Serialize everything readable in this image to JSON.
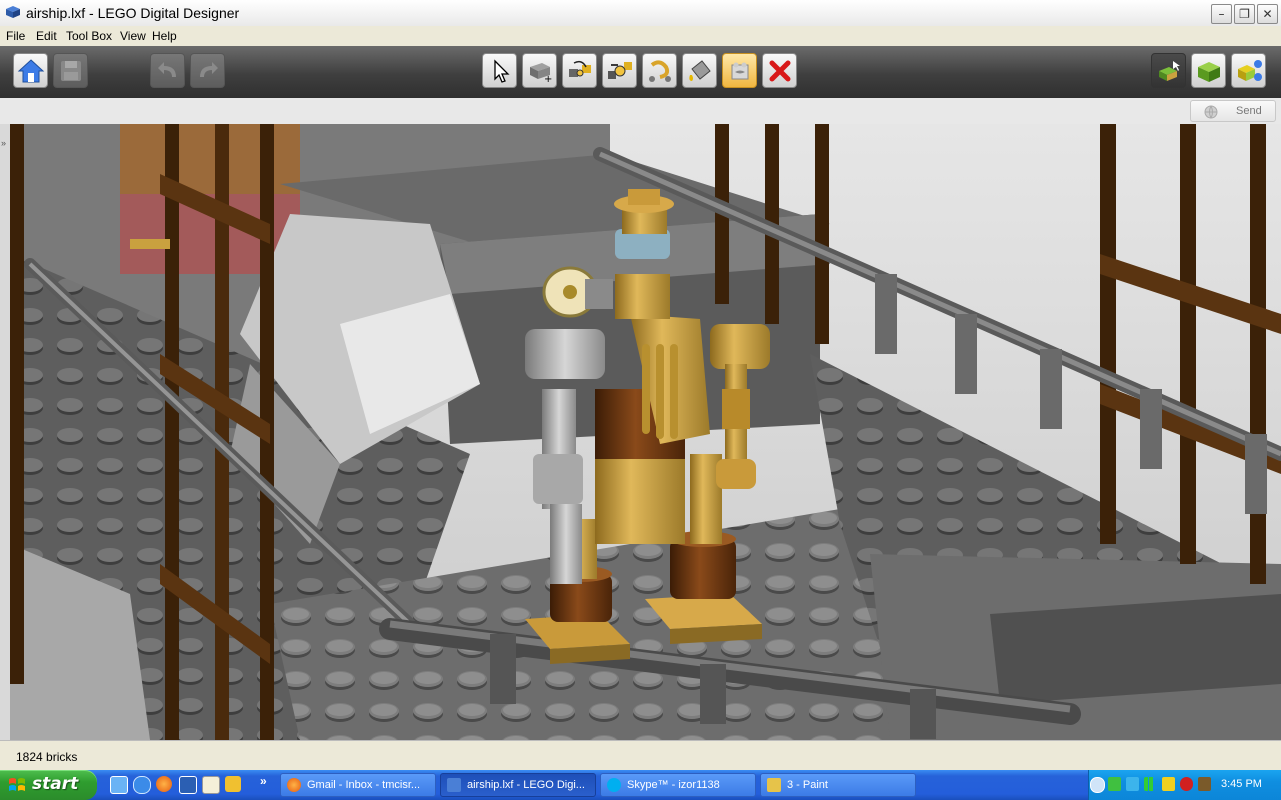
{
  "window": {
    "title": "airship.lxf - LEGO Digital Designer",
    "controls": [
      "minimize",
      "maximize",
      "close"
    ]
  },
  "menu": {
    "items": [
      "File",
      "Edit",
      "Tool Box",
      "View",
      "Help"
    ]
  },
  "toolbar": {
    "left": [
      {
        "name": "home-button",
        "icon": "home-icon"
      },
      {
        "name": "save-button",
        "icon": "floppy-icon"
      },
      {
        "name": "undo-button",
        "icon": "undo-arrow-icon"
      },
      {
        "name": "redo-button",
        "icon": "redo-arrow-icon"
      }
    ],
    "center": [
      {
        "name": "select-tool",
        "icon": "cursor-icon"
      },
      {
        "name": "clone-tool",
        "icon": "clone-brick-icon"
      },
      {
        "name": "hinge-tool",
        "icon": "hinge-icon"
      },
      {
        "name": "hinge-align-tool",
        "icon": "hinge-align-icon"
      },
      {
        "name": "flex-tool",
        "icon": "flex-icon"
      },
      {
        "name": "paint-tool",
        "icon": "paint-bucket-icon"
      },
      {
        "name": "hide-tool",
        "icon": "hide-icon",
        "active": true
      },
      {
        "name": "delete-tool",
        "icon": "red-x-icon"
      }
    ],
    "right": [
      {
        "name": "build-mode-button",
        "icon": "build-mode-icon"
      },
      {
        "name": "view-mode-button",
        "icon": "view-mode-icon"
      },
      {
        "name": "instructions-mode-button",
        "icon": "instructions-mode-icon"
      }
    ]
  },
  "subbar": {
    "send_label": "Send"
  },
  "status": {
    "text": "1824 bricks"
  },
  "taskbar": {
    "start_label": "start",
    "quick_launch": [
      "ie-icon",
      "firefox-icon",
      "word-icon",
      "outlook-icon",
      "tool-icon"
    ],
    "tasks": [
      {
        "label": "Gmail - Inbox - tmcisr...",
        "icon": "firefox-icon"
      },
      {
        "label": "airship.lxf - LEGO Digi...",
        "icon": "lego-designer-icon",
        "active": true
      },
      {
        "label": "Skype™ - izor1138",
        "icon": "skype-icon"
      },
      {
        "label": "3 - Paint",
        "icon": "paint-icon"
      }
    ],
    "clock": "3:45 PM"
  },
  "colors": {
    "toolbar_dark": "#3f3f3f",
    "taskbar_blue": "#245edb",
    "start_green": "#2f9d2f",
    "brick_gray": "#8a8a8a",
    "brick_tan": "#c9a13f",
    "brick_brown": "#6b3a15"
  }
}
